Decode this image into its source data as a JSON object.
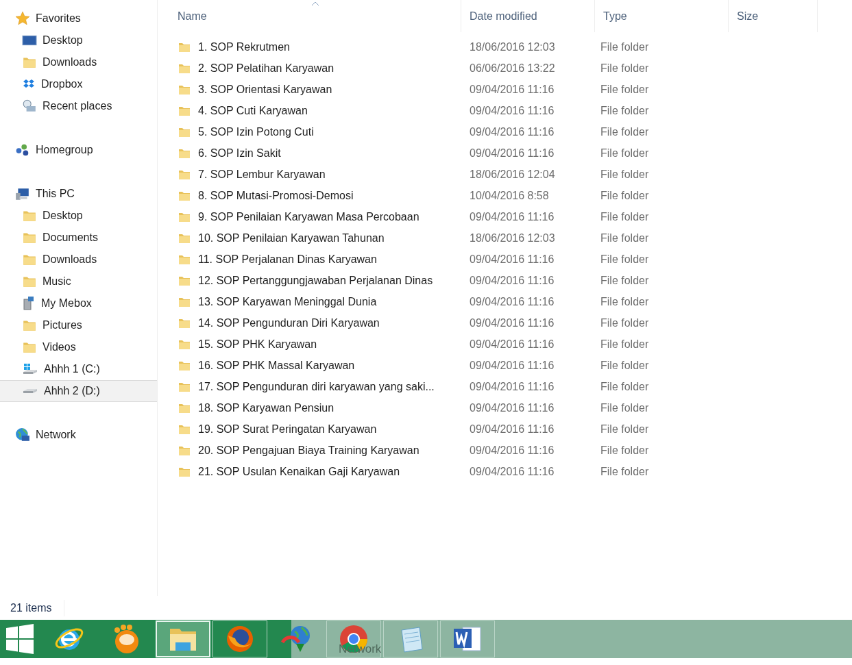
{
  "sidebar": {
    "groups": [
      {
        "label": "Favorites",
        "items": [
          {
            "label": "Desktop",
            "selected": false
          },
          {
            "label": "Downloads",
            "selected": false
          },
          {
            "label": "Dropbox",
            "selected": false
          },
          {
            "label": "Recent places",
            "selected": false
          }
        ]
      },
      {
        "label": "Homegroup"
      },
      {
        "label": "This PC",
        "items": [
          {
            "label": "Desktop",
            "selected": false
          },
          {
            "label": "Documents",
            "selected": false
          },
          {
            "label": "Downloads",
            "selected": false
          },
          {
            "label": "Music",
            "selected": false
          },
          {
            "label": "My Mebox",
            "selected": false
          },
          {
            "label": "Pictures",
            "selected": false
          },
          {
            "label": "Videos",
            "selected": false
          },
          {
            "label": "Ahhh 1 (C:)",
            "selected": false
          },
          {
            "label": "Ahhh 2 (D:)",
            "selected": true
          }
        ]
      },
      {
        "label": "Network"
      }
    ]
  },
  "table": {
    "columns": [
      {
        "label": "Name",
        "sorted": true
      },
      {
        "label": "Date modified",
        "sorted": false
      },
      {
        "label": "Type",
        "sorted": false
      },
      {
        "label": "Size",
        "sorted": false
      }
    ],
    "rows": [
      {
        "name": "1. SOP Rekrutmen",
        "date": "18/06/2016 12:03",
        "type": "File folder"
      },
      {
        "name": "2. SOP Pelatihan Karyawan",
        "date": "06/06/2016 13:22",
        "type": "File folder"
      },
      {
        "name": "3. SOP Orientasi Karyawan",
        "date": "09/04/2016 11:16",
        "type": "File folder"
      },
      {
        "name": "4. SOP Cuti Karyawan",
        "date": "09/04/2016 11:16",
        "type": "File folder"
      },
      {
        "name": "5. SOP Izin Potong Cuti",
        "date": "09/04/2016 11:16",
        "type": "File folder"
      },
      {
        "name": "6. SOP Izin Sakit",
        "date": "09/04/2016 11:16",
        "type": "File folder"
      },
      {
        "name": "7. SOP Lembur Karyawan",
        "date": "18/06/2016 12:04",
        "type": "File folder"
      },
      {
        "name": "8. SOP Mutasi-Promosi-Demosi",
        "date": "10/04/2016 8:58",
        "type": "File folder"
      },
      {
        "name": "9. SOP Penilaian Karyawan Masa Percobaan",
        "date": "09/04/2016 11:16",
        "type": "File folder"
      },
      {
        "name": "10. SOP Penilaian Karyawan Tahunan",
        "date": "18/06/2016 12:03",
        "type": "File folder"
      },
      {
        "name": "11. SOP Perjalanan Dinas Karyawan",
        "date": "09/04/2016 11:16",
        "type": "File folder"
      },
      {
        "name": "12. SOP Pertanggungjawaban Perjalanan Dinas",
        "date": "09/04/2016 11:16",
        "type": "File folder"
      },
      {
        "name": "13. SOP Karyawan Meninggal Dunia",
        "date": "09/04/2016 11:16",
        "type": "File folder"
      },
      {
        "name": "14. SOP Pengunduran Diri Karyawan",
        "date": "09/04/2016 11:16",
        "type": "File folder"
      },
      {
        "name": "15. SOP PHK Karyawan",
        "date": "09/04/2016 11:16",
        "type": "File folder"
      },
      {
        "name": "16. SOP PHK Massal Karyawan",
        "date": "09/04/2016 11:16",
        "type": "File folder"
      },
      {
        "name": "17. SOP Pengunduran diri karyawan yang saki...",
        "date": "09/04/2016 11:16",
        "type": "File folder"
      },
      {
        "name": "18. SOP Karyawan Pensiun",
        "date": "09/04/2016 11:16",
        "type": "File folder"
      },
      {
        "name": "19. SOP Surat Peringatan Karyawan",
        "date": "09/04/2016 11:16",
        "type": "File folder"
      },
      {
        "name": "20. SOP Pengajuan Biaya Training Karyawan",
        "date": "09/04/2016 11:16",
        "type": "File folder"
      },
      {
        "name": "21. SOP Usulan Kenaikan Gaji Karyawan",
        "date": "09/04/2016 11:16",
        "type": "File folder"
      }
    ]
  },
  "status_bar": {
    "count": "21 items"
  },
  "taskbar": {
    "buttons": [
      {
        "active": false
      },
      {
        "active": false
      },
      {
        "active": false
      },
      {
        "active": true
      },
      {
        "active": false
      },
      {
        "active": false
      },
      {
        "active": false
      },
      {
        "active": false
      },
      {
        "active": false
      }
    ],
    "drag_ghost": "Network"
  }
}
